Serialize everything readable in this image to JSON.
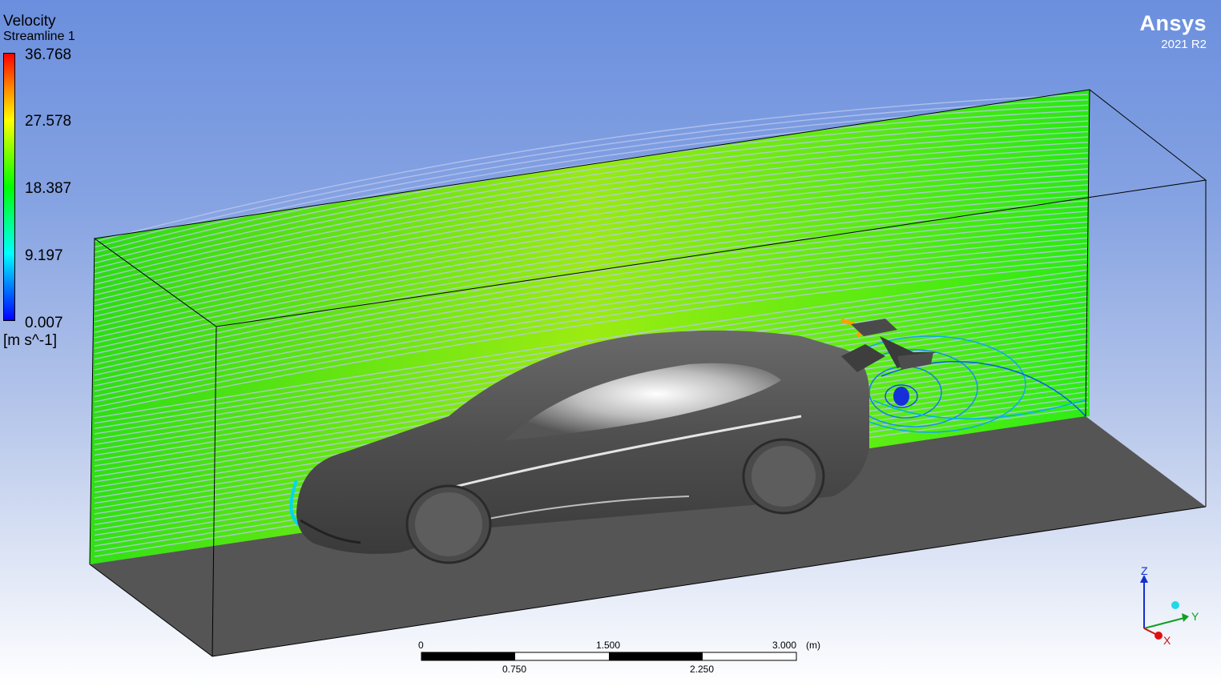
{
  "legend": {
    "title": "Velocity",
    "subtitle": "Streamline 1",
    "ticks": [
      "36.768",
      "27.578",
      "18.387",
      "9.197",
      "0.007"
    ],
    "unit": "[m s^-1]"
  },
  "brand": {
    "name": "Ansys",
    "version": "2021 R2"
  },
  "scale_bar": {
    "top_labels": [
      "0",
      "1.500",
      "3.000"
    ],
    "unit": "(m)",
    "bottom_labels": [
      "0.750",
      "2.250"
    ]
  },
  "axes_triad": {
    "z": "Z",
    "y": "Y",
    "x": "X"
  },
  "colors": {
    "background_top": "#6b8fde",
    "background_bottom": "#ffffff",
    "car_body": "#5a5a5a",
    "ground": "#555555"
  }
}
